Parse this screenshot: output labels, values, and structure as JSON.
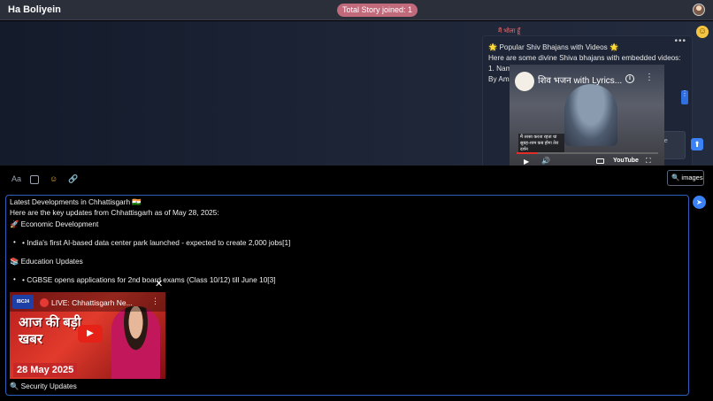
{
  "header": {
    "title": "Ha Boliyein",
    "badge": "Total Story joined: 1"
  },
  "chat": {
    "sender": "मैं भोला हूँ",
    "more": "•••",
    "message_lines": [
      "🌟 Popular Shiv Bhajans with Videos 🌟",
      "Here are some divine Shiva bhajans with embedded videos:",
      "1. Namo Namo Hey Sankara",
      "By Amit Trivedi (0:00 - 5:19) 🎵"
    ],
    "video": {
      "title": "शिव भजन with Lyrics...",
      "caption": "मैं तरसा करता रहता था सुबह-शाम\nकब होगा तेरा दर्शन",
      "brand": "YouTube",
      "progress": 0.15
    },
    "prompt_placeholder": "i.e. write real time prompt",
    "icons": {
      "upload": "upload-arrow-icon",
      "menu": "vertical-dots-icon"
    }
  },
  "toolbar": {
    "font_label": "Aa",
    "images_label": "🔍 images"
  },
  "editor": {
    "lines": {
      "heading": "Latest Developments in Chhattisgarh 🇮🇳",
      "intro": "Here are the key updates from Chhattisgarh as of May 28, 2025:",
      "econ_head": "🚀 Economic Development",
      "econ_item": "• India's first AI-based data center park launched - expected to create 2,000 jobs[1]",
      "edu_head": "📚 Education Updates",
      "edu_item": "• CGBSE opens applications for 2nd board exams (Class 10/12) till June 10[3]",
      "sec_head": "🔍 Security Updates"
    },
    "news_video": {
      "channel": "IBC24",
      "title": "LIVE: Chhattisgarh Ne...",
      "headline": "आज की बड़ी खबर",
      "date": "28 May 2025"
    }
  }
}
